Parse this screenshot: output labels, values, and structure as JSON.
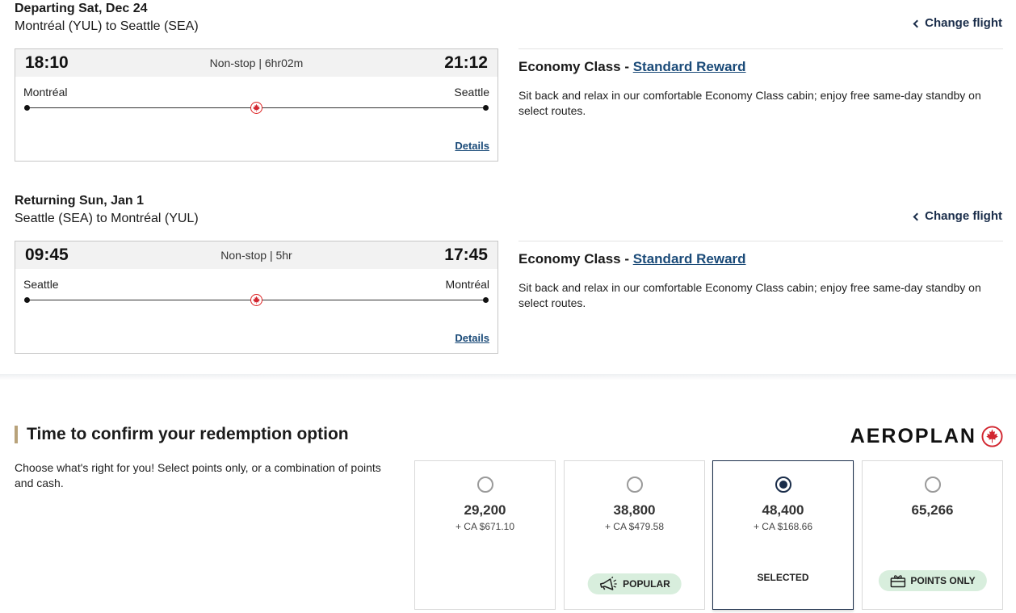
{
  "departing": {
    "date": "Departing Sat, Dec 24",
    "route": "Montréal (YUL) to Seattle (SEA)",
    "change_flight": "Change flight",
    "depart_time": "18:10",
    "arrive_time": "21:12",
    "duration": "Non-stop | 6hr02m",
    "origin_city": "Montréal",
    "dest_city": "Seattle",
    "details": "Details",
    "cabin_class": "Economy Class - ",
    "fare_type": "Standard Reward",
    "cabin_desc": "Sit back and relax in our comfortable Economy Class cabin; enjoy free same-day standby on select routes."
  },
  "returning": {
    "date": "Returning Sun, Jan 1",
    "route": "Seattle (SEA) to Montréal (YUL)",
    "change_flight": "Change flight",
    "depart_time": "09:45",
    "arrive_time": "17:45",
    "duration": "Non-stop | 5hr",
    "origin_city": "Seattle",
    "dest_city": "Montréal",
    "details": "Details",
    "cabin_class": "Economy Class - ",
    "fare_type": "Standard Reward",
    "cabin_desc": "Sit back and relax in our comfortable Economy Class cabin; enjoy free same-day standby on select routes."
  },
  "redemption": {
    "title": "Time to confirm your redemption option",
    "subtitle": "Choose what's right for you! Select points only, or a combination of points and cash.",
    "brand": "AEROPLAN",
    "options": [
      {
        "points": "29,200",
        "cash": "+ CA $671.10",
        "selected": false
      },
      {
        "points": "38,800",
        "cash": "+ CA $479.58",
        "badge": "POPULAR",
        "selected": false
      },
      {
        "points": "48,400",
        "cash": "+ CA $168.66",
        "status": "SELECTED",
        "selected": true
      },
      {
        "points": "65,266",
        "badge": "POINTS ONLY",
        "selected": false
      }
    ]
  },
  "colors": {
    "accent_navy": "#1a2d4a",
    "brand_red": "#d22630",
    "badge_green": "#d8eedd",
    "link_blue": "#1a4a78"
  }
}
